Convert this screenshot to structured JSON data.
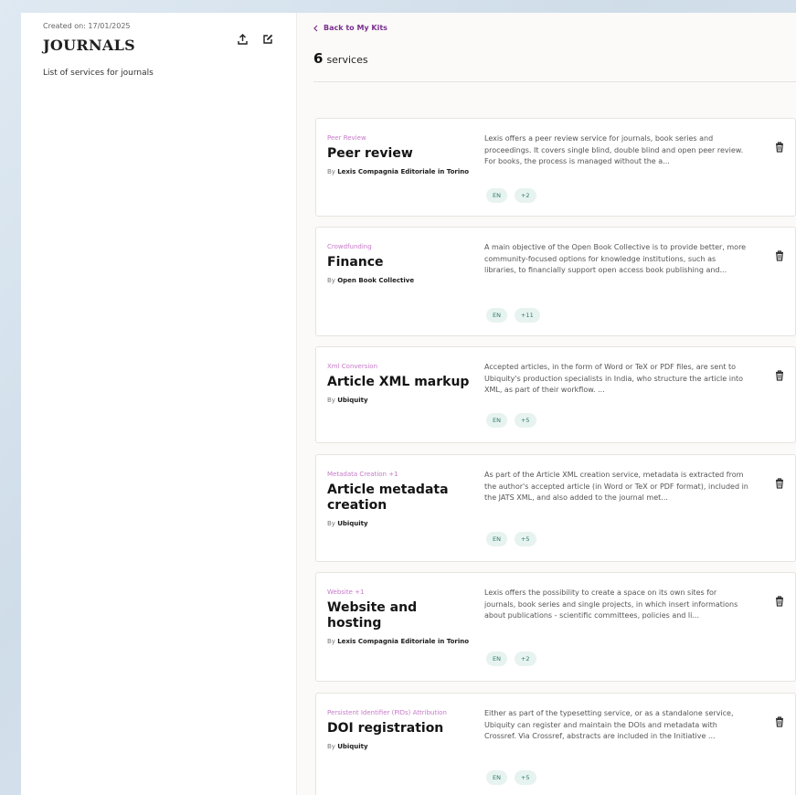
{
  "sidebar": {
    "created": "Created on: 17/01/2025",
    "title": "JOURNALS",
    "description": "List of services for journals",
    "icons": [
      "upload-icon",
      "edit-icon"
    ]
  },
  "main": {
    "back_label": "Back to My Kits",
    "count": "6",
    "count_label": "services",
    "cards": [
      {
        "category": "Peer Review",
        "title": "Peer review",
        "by_prefix": "By",
        "provider": "Lexis Compagnia Editoriale in Torino",
        "description": "Lexis offers a peer review service for journals, book series and proceedings. It covers single blind, double blind and open peer review. For books, the process is managed without the a...",
        "tags": [
          "EN",
          "+2"
        ]
      },
      {
        "category": "Crowdfunding",
        "title": "Finance",
        "by_prefix": "By",
        "provider": "Open Book Collective",
        "description": "A main objective of the Open Book Collective is to provide better, more community-focused options for knowledge institutions, such as libraries, to financially support open access book publishing and...",
        "tags": [
          "EN",
          "+11"
        ]
      },
      {
        "category": "Xml Conversion",
        "title": "Article XML markup",
        "by_prefix": "By",
        "provider": "Ubiquity",
        "description": "Accepted articles, in the form of Word or TeX or PDF files, are sent to Ubiquity's production specialists in India, who structure the article into XML, as part of their workflow. ...",
        "tags": [
          "EN",
          "+5"
        ]
      },
      {
        "category": "Metadata Creation +1",
        "title": "Article metadata creation",
        "by_prefix": "By",
        "provider": "Ubiquity",
        "description": "As part of the Article XML creation service, metadata is extracted from the author's accepted article (in Word or TeX or PDF format), included in the JATS XML, and also added to the journal met...",
        "tags": [
          "EN",
          "+5"
        ]
      },
      {
        "category": "Website +1",
        "title": "Website and hosting",
        "by_prefix": "By",
        "provider": "Lexis Compagnia Editoriale in Torino",
        "description": "Lexis offers the possibility to create a space on its own sites for journals, book series and single projects, in which insert informations about publications - scientific committees, policies and li...",
        "tags": [
          "EN",
          "+2"
        ]
      },
      {
        "category": "Persistent Identifier (PIDs) Attribution",
        "title": "DOI registration",
        "by_prefix": "By",
        "provider": "Ubiquity",
        "description": "Either as part of the typesetting service, or as a standalone service, Ubiquity can register and maintain the DOIs and metadata with Crossref. Via Crossref, abstracts are included in the Initiative ...",
        "tags": [
          "EN",
          "+5"
        ]
      }
    ]
  },
  "colors": {
    "accent": "#7a2f8f",
    "category": "#c779c9",
    "tag_text": "#2c7c6e",
    "tag_bg": "#e7f3f0"
  }
}
